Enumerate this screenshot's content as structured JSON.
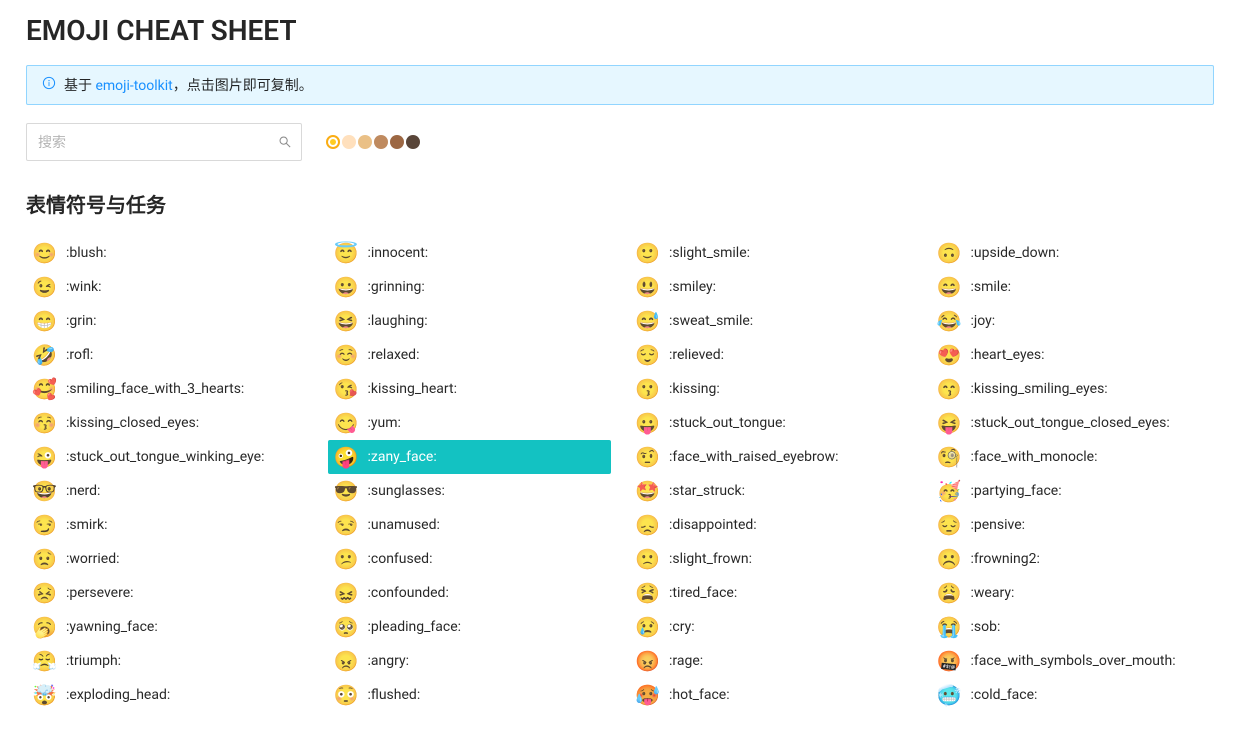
{
  "header": {
    "title": "EMOJI CHEAT SHEET"
  },
  "alert": {
    "prefix": "基于 ",
    "link_text": "emoji-toolkit",
    "suffix": "，点击图片即可复制。"
  },
  "search": {
    "placeholder": "搜索",
    "value": ""
  },
  "skin_tones": {
    "selected_index": 0,
    "colors": [
      "#ffcc22",
      "#ffe0bd",
      "#eac086",
      "#bf8a5f",
      "#9c6743",
      "#594539"
    ]
  },
  "section": {
    "title": "表情符号与任务"
  },
  "emojis": [
    {
      "glyph": "😊",
      "code": ":blush:"
    },
    {
      "glyph": "😇",
      "code": ":innocent:"
    },
    {
      "glyph": "🙂",
      "code": ":slight_smile:"
    },
    {
      "glyph": "🙃",
      "code": ":upside_down:"
    },
    {
      "glyph": "😉",
      "code": ":wink:"
    },
    {
      "glyph": "😀",
      "code": ":grinning:"
    },
    {
      "glyph": "😃",
      "code": ":smiley:"
    },
    {
      "glyph": "😄",
      "code": ":smile:"
    },
    {
      "glyph": "😁",
      "code": ":grin:"
    },
    {
      "glyph": "😆",
      "code": ":laughing:"
    },
    {
      "glyph": "😅",
      "code": ":sweat_smile:"
    },
    {
      "glyph": "😂",
      "code": ":joy:"
    },
    {
      "glyph": "🤣",
      "code": ":rofl:"
    },
    {
      "glyph": "☺️",
      "code": ":relaxed:"
    },
    {
      "glyph": "😌",
      "code": ":relieved:"
    },
    {
      "glyph": "😍",
      "code": ":heart_eyes:"
    },
    {
      "glyph": "🥰",
      "code": ":smiling_face_with_3_hearts:"
    },
    {
      "glyph": "😘",
      "code": ":kissing_heart:"
    },
    {
      "glyph": "😗",
      "code": ":kissing:"
    },
    {
      "glyph": "😙",
      "code": ":kissing_smiling_eyes:"
    },
    {
      "glyph": "😚",
      "code": ":kissing_closed_eyes:"
    },
    {
      "glyph": "😋",
      "code": ":yum:"
    },
    {
      "glyph": "😛",
      "code": ":stuck_out_tongue:"
    },
    {
      "glyph": "😝",
      "code": ":stuck_out_tongue_closed_eyes:"
    },
    {
      "glyph": "😜",
      "code": ":stuck_out_tongue_winking_eye:"
    },
    {
      "glyph": "🤪",
      "code": ":zany_face:",
      "highlighted": true
    },
    {
      "glyph": "🤨",
      "code": ":face_with_raised_eyebrow:"
    },
    {
      "glyph": "🧐",
      "code": ":face_with_monocle:"
    },
    {
      "glyph": "🤓",
      "code": ":nerd:"
    },
    {
      "glyph": "😎",
      "code": ":sunglasses:"
    },
    {
      "glyph": "🤩",
      "code": ":star_struck:"
    },
    {
      "glyph": "🥳",
      "code": ":partying_face:"
    },
    {
      "glyph": "😏",
      "code": ":smirk:"
    },
    {
      "glyph": "😒",
      "code": ":unamused:"
    },
    {
      "glyph": "😞",
      "code": ":disappointed:"
    },
    {
      "glyph": "😔",
      "code": ":pensive:"
    },
    {
      "glyph": "😟",
      "code": ":worried:"
    },
    {
      "glyph": "😕",
      "code": ":confused:"
    },
    {
      "glyph": "🙁",
      "code": ":slight_frown:"
    },
    {
      "glyph": "☹️",
      "code": ":frowning2:"
    },
    {
      "glyph": "😣",
      "code": ":persevere:"
    },
    {
      "glyph": "😖",
      "code": ":confounded:"
    },
    {
      "glyph": "😫",
      "code": ":tired_face:"
    },
    {
      "glyph": "😩",
      "code": ":weary:"
    },
    {
      "glyph": "🥱",
      "code": ":yawning_face:"
    },
    {
      "glyph": "🥺",
      "code": ":pleading_face:"
    },
    {
      "glyph": "😢",
      "code": ":cry:"
    },
    {
      "glyph": "😭",
      "code": ":sob:"
    },
    {
      "glyph": "😤",
      "code": ":triumph:"
    },
    {
      "glyph": "😠",
      "code": ":angry:"
    },
    {
      "glyph": "😡",
      "code": ":rage:"
    },
    {
      "glyph": "🤬",
      "code": ":face_with_symbols_over_mouth:"
    },
    {
      "glyph": "🤯",
      "code": ":exploding_head:"
    },
    {
      "glyph": "😳",
      "code": ":flushed:"
    },
    {
      "glyph": "🥵",
      "code": ":hot_face:"
    },
    {
      "glyph": "🥶",
      "code": ":cold_face:"
    }
  ]
}
